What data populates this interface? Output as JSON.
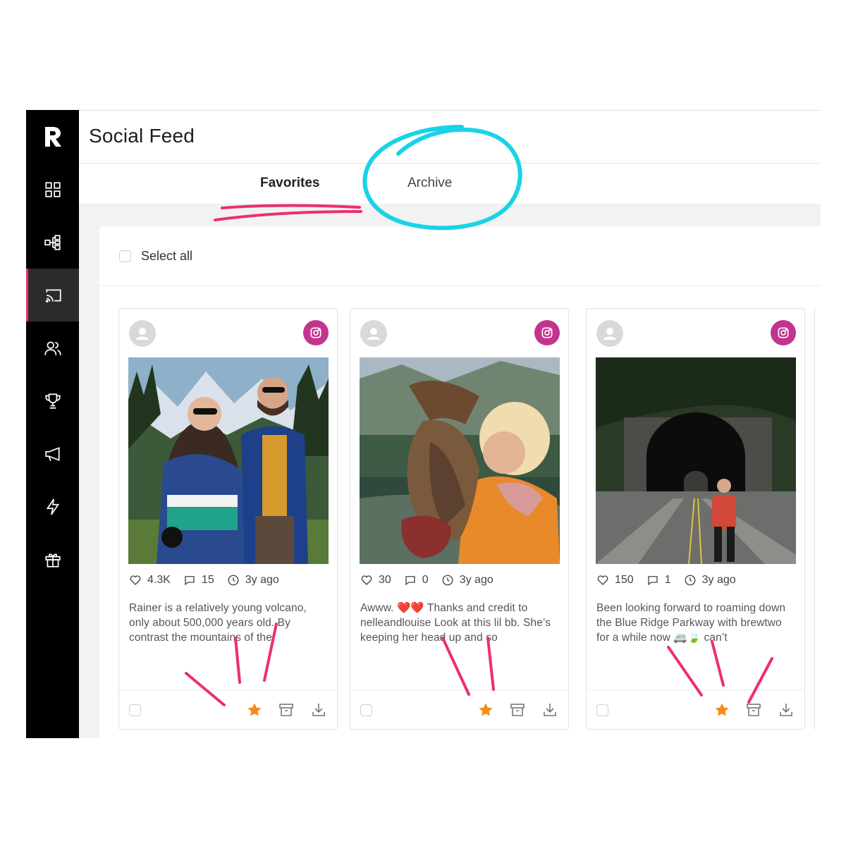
{
  "app": {
    "page_title": "Social Feed"
  },
  "sidebar": {
    "items": [
      {
        "icon": "dashboard-grid-icon"
      },
      {
        "icon": "workflow-icon"
      },
      {
        "icon": "cast-icon",
        "active": true
      },
      {
        "icon": "users-icon"
      },
      {
        "icon": "trophy-icon"
      },
      {
        "icon": "megaphone-icon"
      },
      {
        "icon": "lightning-icon"
      },
      {
        "icon": "gift-icon"
      }
    ]
  },
  "tabs": [
    {
      "label": "Favorites",
      "active": true
    },
    {
      "label": "Archive",
      "active": false
    }
  ],
  "toolbar": {
    "select_all_label": "Select all"
  },
  "posts": [
    {
      "likes": "4.3K",
      "comments": "15",
      "time": "3y ago",
      "caption": "Rainer is a relatively young volcano, only about 500,000 years old. By contrast the mountains of the",
      "favorited": true,
      "photo": "Couple hiking with mountains and evergreen forest"
    },
    {
      "likes": "30",
      "comments": "0",
      "time": "3y ago",
      "caption": "Awww. ❤️❤️ Thanks and credit to nelleandlouise Look at this lil bb. She’s keeping her head up and so",
      "favorited": true,
      "photo": "Woman hugging a dog near a mountain lake"
    },
    {
      "likes": "150",
      "comments": "1",
      "time": "3y ago",
      "caption": "Been looking forward to roaming down the Blue Ridge Parkway with brewtwo for a while now 🚐🍃 can’t",
      "favorited": true,
      "photo": "Woman standing on a road in front of a stone tunnel"
    }
  ],
  "colors": {
    "sidebar_bg": "#000000",
    "accent_pink": "#e6336e",
    "instagram": "#c1358f",
    "favorite_star": "#f28c16",
    "annotation_cyan": "#19d3e6",
    "annotation_pink": "#ec2f6d"
  }
}
